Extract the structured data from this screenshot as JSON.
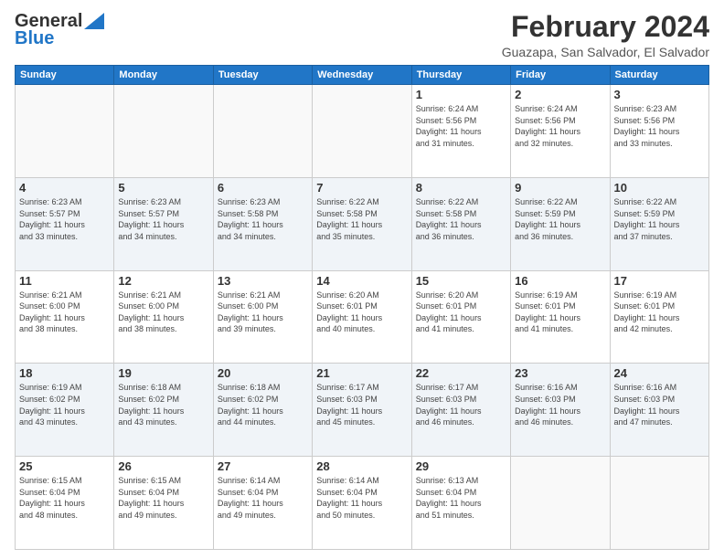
{
  "header": {
    "logo_line1": "General",
    "logo_line2": "Blue",
    "month": "February 2024",
    "location": "Guazapa, San Salvador, El Salvador"
  },
  "weekdays": [
    "Sunday",
    "Monday",
    "Tuesday",
    "Wednesday",
    "Thursday",
    "Friday",
    "Saturday"
  ],
  "weeks": [
    [
      {
        "day": "",
        "info": ""
      },
      {
        "day": "",
        "info": ""
      },
      {
        "day": "",
        "info": ""
      },
      {
        "day": "",
        "info": ""
      },
      {
        "day": "1",
        "info": "Sunrise: 6:24 AM\nSunset: 5:56 PM\nDaylight: 11 hours\nand 31 minutes."
      },
      {
        "day": "2",
        "info": "Sunrise: 6:24 AM\nSunset: 5:56 PM\nDaylight: 11 hours\nand 32 minutes."
      },
      {
        "day": "3",
        "info": "Sunrise: 6:23 AM\nSunset: 5:56 PM\nDaylight: 11 hours\nand 33 minutes."
      }
    ],
    [
      {
        "day": "4",
        "info": "Sunrise: 6:23 AM\nSunset: 5:57 PM\nDaylight: 11 hours\nand 33 minutes."
      },
      {
        "day": "5",
        "info": "Sunrise: 6:23 AM\nSunset: 5:57 PM\nDaylight: 11 hours\nand 34 minutes."
      },
      {
        "day": "6",
        "info": "Sunrise: 6:23 AM\nSunset: 5:58 PM\nDaylight: 11 hours\nand 34 minutes."
      },
      {
        "day": "7",
        "info": "Sunrise: 6:22 AM\nSunset: 5:58 PM\nDaylight: 11 hours\nand 35 minutes."
      },
      {
        "day": "8",
        "info": "Sunrise: 6:22 AM\nSunset: 5:58 PM\nDaylight: 11 hours\nand 36 minutes."
      },
      {
        "day": "9",
        "info": "Sunrise: 6:22 AM\nSunset: 5:59 PM\nDaylight: 11 hours\nand 36 minutes."
      },
      {
        "day": "10",
        "info": "Sunrise: 6:22 AM\nSunset: 5:59 PM\nDaylight: 11 hours\nand 37 minutes."
      }
    ],
    [
      {
        "day": "11",
        "info": "Sunrise: 6:21 AM\nSunset: 6:00 PM\nDaylight: 11 hours\nand 38 minutes."
      },
      {
        "day": "12",
        "info": "Sunrise: 6:21 AM\nSunset: 6:00 PM\nDaylight: 11 hours\nand 38 minutes."
      },
      {
        "day": "13",
        "info": "Sunrise: 6:21 AM\nSunset: 6:00 PM\nDaylight: 11 hours\nand 39 minutes."
      },
      {
        "day": "14",
        "info": "Sunrise: 6:20 AM\nSunset: 6:01 PM\nDaylight: 11 hours\nand 40 minutes."
      },
      {
        "day": "15",
        "info": "Sunrise: 6:20 AM\nSunset: 6:01 PM\nDaylight: 11 hours\nand 41 minutes."
      },
      {
        "day": "16",
        "info": "Sunrise: 6:19 AM\nSunset: 6:01 PM\nDaylight: 11 hours\nand 41 minutes."
      },
      {
        "day": "17",
        "info": "Sunrise: 6:19 AM\nSunset: 6:01 PM\nDaylight: 11 hours\nand 42 minutes."
      }
    ],
    [
      {
        "day": "18",
        "info": "Sunrise: 6:19 AM\nSunset: 6:02 PM\nDaylight: 11 hours\nand 43 minutes."
      },
      {
        "day": "19",
        "info": "Sunrise: 6:18 AM\nSunset: 6:02 PM\nDaylight: 11 hours\nand 43 minutes."
      },
      {
        "day": "20",
        "info": "Sunrise: 6:18 AM\nSunset: 6:02 PM\nDaylight: 11 hours\nand 44 minutes."
      },
      {
        "day": "21",
        "info": "Sunrise: 6:17 AM\nSunset: 6:03 PM\nDaylight: 11 hours\nand 45 minutes."
      },
      {
        "day": "22",
        "info": "Sunrise: 6:17 AM\nSunset: 6:03 PM\nDaylight: 11 hours\nand 46 minutes."
      },
      {
        "day": "23",
        "info": "Sunrise: 6:16 AM\nSunset: 6:03 PM\nDaylight: 11 hours\nand 46 minutes."
      },
      {
        "day": "24",
        "info": "Sunrise: 6:16 AM\nSunset: 6:03 PM\nDaylight: 11 hours\nand 47 minutes."
      }
    ],
    [
      {
        "day": "25",
        "info": "Sunrise: 6:15 AM\nSunset: 6:04 PM\nDaylight: 11 hours\nand 48 minutes."
      },
      {
        "day": "26",
        "info": "Sunrise: 6:15 AM\nSunset: 6:04 PM\nDaylight: 11 hours\nand 49 minutes."
      },
      {
        "day": "27",
        "info": "Sunrise: 6:14 AM\nSunset: 6:04 PM\nDaylight: 11 hours\nand 49 minutes."
      },
      {
        "day": "28",
        "info": "Sunrise: 6:14 AM\nSunset: 6:04 PM\nDaylight: 11 hours\nand 50 minutes."
      },
      {
        "day": "29",
        "info": "Sunrise: 6:13 AM\nSunset: 6:04 PM\nDaylight: 11 hours\nand 51 minutes."
      },
      {
        "day": "",
        "info": ""
      },
      {
        "day": "",
        "info": ""
      }
    ]
  ]
}
